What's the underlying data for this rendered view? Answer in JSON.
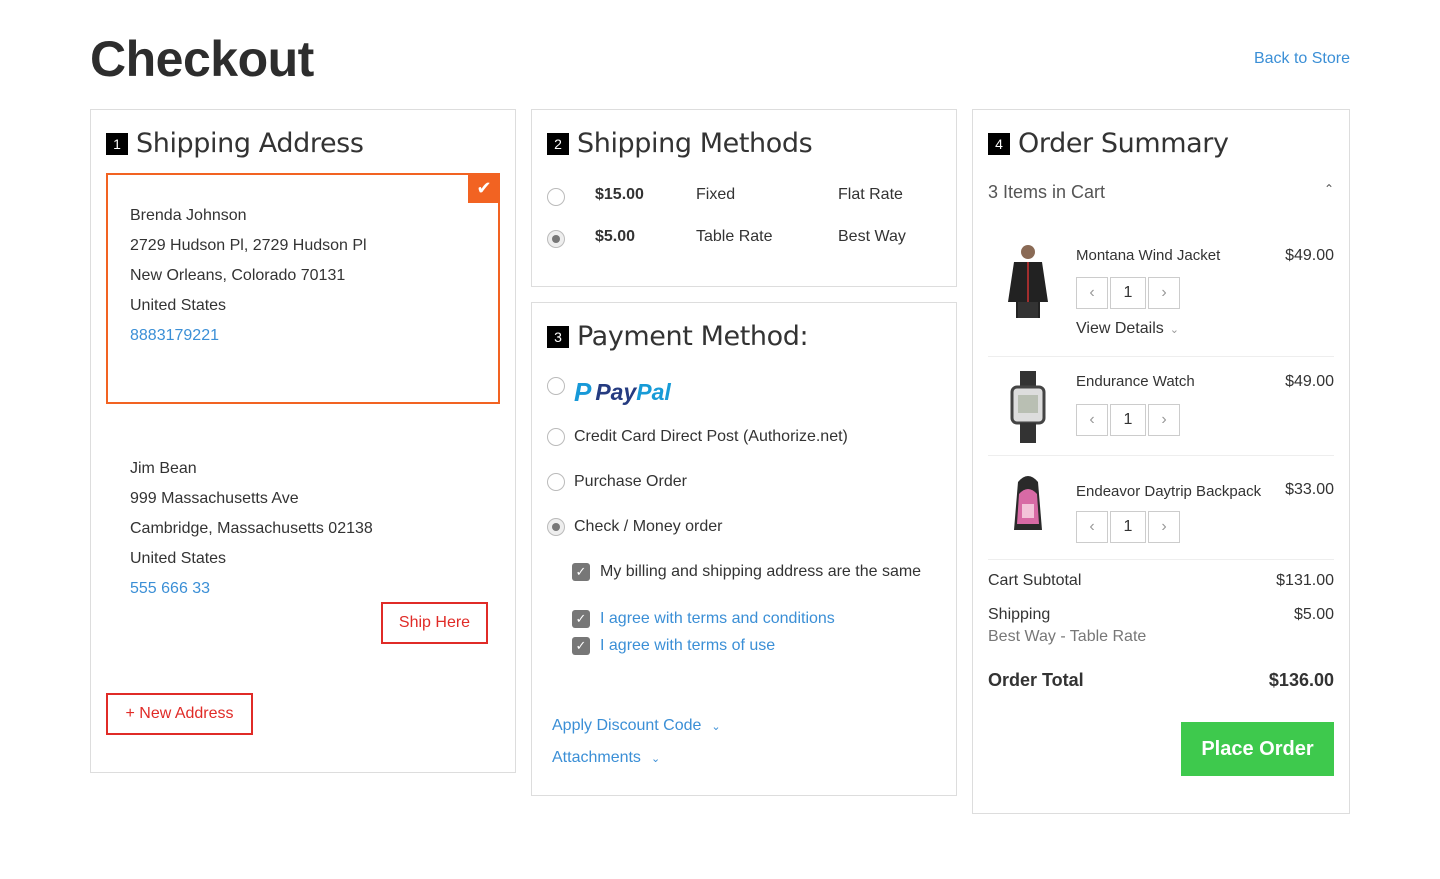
{
  "page": {
    "title": "Checkout",
    "back_link": "Back to Store"
  },
  "shipping_address": {
    "step": "1",
    "title": "Shipping Address",
    "selected": {
      "name": "Brenda Johnson",
      "street": "2729 Hudson Pl, 2729 Hudson Pl",
      "city_line": "New Orleans, Colorado 70131",
      "country": "United States",
      "phone": "8883179221"
    },
    "other": {
      "name": "Jim Bean",
      "street": "999 Massachusetts Ave",
      "city_line": "Cambridge, Massachusetts 02138",
      "country": "United States",
      "phone": "555 666 33",
      "ship_here_label": "Ship Here"
    },
    "new_address_label": "+ New Address"
  },
  "shipping_methods": {
    "step": "2",
    "title": "Shipping Methods",
    "options": [
      {
        "price": "$15.00",
        "method": "Fixed",
        "carrier": "Flat Rate",
        "selected": false
      },
      {
        "price": "$5.00",
        "method": "Table Rate",
        "carrier": "Best Way",
        "selected": true
      }
    ]
  },
  "payment": {
    "step": "3",
    "title": "Payment Method:",
    "paypal_pay": "Pay",
    "paypal_pal": "Pal",
    "options": [
      {
        "label": "Credit Card Direct Post (Authorize.net)"
      },
      {
        "label": "Purchase Order"
      },
      {
        "label": "Check / Money order"
      }
    ],
    "billing_same": "My billing and shipping address are the same",
    "terms_conditions": "I agree with terms and conditions",
    "terms_use": "I agree with terms of use",
    "discount": "Apply Discount Code",
    "attachments": "Attachments"
  },
  "summary": {
    "step": "4",
    "title": "Order Summary",
    "items_in_cart": "3 Items in Cart",
    "items": [
      {
        "name": "Montana Wind Jacket",
        "price": "$49.00",
        "qty": "1",
        "view_details": "View Details"
      },
      {
        "name": "Endurance Watch",
        "price": "$49.00",
        "qty": "1"
      },
      {
        "name": "Endeavor Daytrip Backpack",
        "price": "$33.00",
        "qty": "1"
      }
    ],
    "subtotal_label": "Cart Subtotal",
    "subtotal_value": "$131.00",
    "shipping_label": "Shipping",
    "shipping_value": "$5.00",
    "shipping_method": "Best Way - Table Rate",
    "total_label": "Order Total",
    "total_value": "$136.00",
    "place_order": "Place Order"
  },
  "colors": {
    "accent": "#f26322",
    "danger": "#e02b27",
    "link": "#3b8fd6",
    "place_order": "#3ec94d"
  }
}
